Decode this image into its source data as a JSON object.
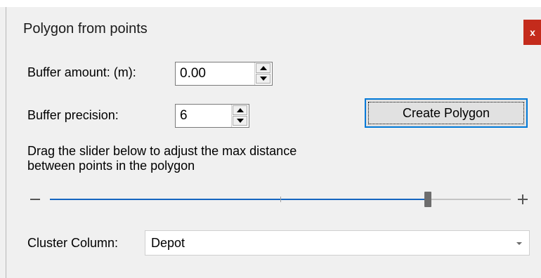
{
  "dialog": {
    "title": "Polygon from points",
    "close_label": "x"
  },
  "buffer_amount": {
    "label": "Buffer amount: (m):",
    "value": "0.00"
  },
  "buffer_precision": {
    "label": "Buffer precision:",
    "value": "6"
  },
  "create_button": {
    "label": "Create Polygon"
  },
  "slider": {
    "description_line1": "Drag the slider below to adjust the max distance",
    "description_line2": "between points in the polygon",
    "position_fraction": 0.82,
    "fill_color": "#1565c0"
  },
  "cluster_column": {
    "label": "Cluster Column:",
    "selected": "Depot"
  },
  "icons": {
    "close": "close-icon",
    "spin_up": "spin-up-icon",
    "spin_down": "spin-down-icon",
    "minus": "minus-icon",
    "plus": "plus-icon",
    "dropdown": "chevron-down-icon"
  }
}
